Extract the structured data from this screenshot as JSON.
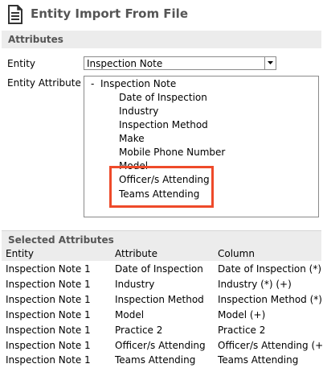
{
  "window": {
    "title": "Entity Import From File",
    "icon": "document-lines-icon"
  },
  "attributes_section": {
    "heading": "Attributes",
    "entity_label": "Entity",
    "entity_value": "Inspection Note",
    "entity_attribute_label": "Entity Attribute",
    "tree": {
      "root_toggle": "-",
      "root": "Inspection Note",
      "items": [
        "Date of Inspection",
        "Industry",
        "Inspection Method",
        "Make",
        "Mobile Phone Number",
        "Model",
        "Officer/s Attending",
        "Teams Attending"
      ]
    },
    "highlight_color": "#ee4a2a"
  },
  "selected_section": {
    "heading": "Selected Attributes",
    "columns": [
      "Entity",
      "Attribute",
      "Column"
    ],
    "rows": [
      [
        "Inspection Note 1",
        "Date of Inspection",
        "Date of Inspection (*)"
      ],
      [
        "Inspection Note 1",
        "Industry",
        "Industry (*) (+)"
      ],
      [
        "Inspection Note 1",
        "Inspection Method",
        "Inspection Method (*)"
      ],
      [
        "Inspection Note 1",
        "Model",
        "Model (+)"
      ],
      [
        "Inspection Note 1",
        "Practice 2",
        "Practice 2"
      ],
      [
        "Inspection Note 1",
        "Officer/s Attending",
        "Officer/s Attending (+)"
      ],
      [
        "Inspection Note 1",
        "Teams Attending",
        "Teams Attending"
      ]
    ]
  }
}
